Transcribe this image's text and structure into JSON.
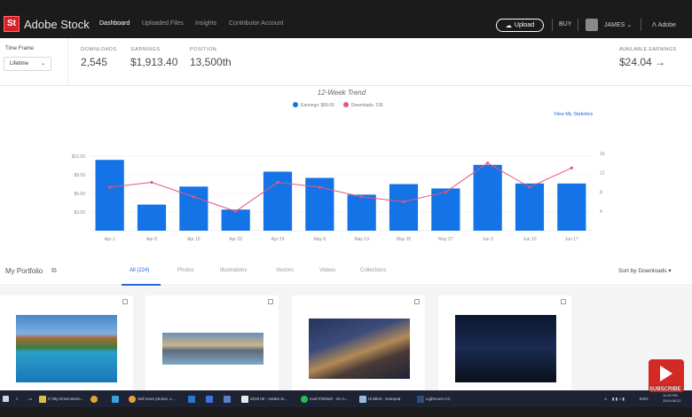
{
  "nav": {
    "brand": "Adobe Stock",
    "logo": "St",
    "items": [
      "Dashboard",
      "Uploaded Files",
      "Insights",
      "Contributor Account"
    ],
    "upload": "Upload",
    "buy": "BUY",
    "user": "JAMES",
    "user_chevron": "⌄",
    "adobe": "Adobe"
  },
  "stats": {
    "timeframe_label": "Time Frame",
    "timeframe_value": "Lifetime",
    "downloads_label": "DOWNLOADS",
    "downloads_value": "2,545",
    "earnings_label": "EARNINGS",
    "earnings_value": "$1,913.40",
    "position_label": "POSITION",
    "position_value": "13,500th",
    "available_label": "AVAILABLE EARNINGS",
    "available_value": "$24.04 →"
  },
  "chart_data": {
    "type": "bar",
    "title": "12-Week Trend",
    "legend": [
      "Earnings: $89.00",
      "Downloads: 106"
    ],
    "view_stats": "View My Statistics",
    "categories": [
      "Apr 1",
      "Apr 8",
      "Apr 15",
      "Apr 22",
      "Apr 29",
      "May 6",
      "May 13",
      "May 20",
      "May 27",
      "Jun 3",
      "Jun 10",
      "Jun 17"
    ],
    "left_ticks": [
      "$3.00",
      "$6.00",
      "$9.00",
      "$12.00"
    ],
    "left_tick_values": [
      3,
      6,
      9,
      12
    ],
    "right_ticks": [
      "4",
      "8",
      "12",
      "16"
    ],
    "right_tick_values": [
      4,
      8,
      12,
      16
    ],
    "ylim_left": [
      0,
      14
    ],
    "ylim_right": [
      0,
      18
    ],
    "series": [
      {
        "name": "Earnings: $89.00",
        "kind": "bar",
        "axis": "left",
        "color": "#1473e6",
        "values": [
          11.4,
          4.2,
          7.1,
          3.4,
          9.5,
          8.5,
          5.8,
          7.5,
          6.8,
          10.6,
          7.6,
          7.6
        ]
      },
      {
        "name": "Downloads: 106",
        "kind": "line",
        "axis": "right",
        "color": "#e8567a",
        "values": [
          9,
          10,
          7,
          4,
          10,
          9,
          7,
          6,
          8,
          14,
          9,
          13
        ]
      }
    ]
  },
  "portfolio": {
    "title": "My Portfolio",
    "ext_icon": "⧉",
    "tabs": [
      "All (224)",
      "Photos",
      "Illustrations",
      "Vectors",
      "Videos",
      "Collections"
    ],
    "sort": "Sort by Downloads ▾"
  },
  "taskbar": {
    "items": [
      "C:\\My Drive\\Jamie...",
      "Sell more photos, v...",
      "2019 06 - Adobe st...",
      "Iced Pinkbelt - On A...",
      "Untitled - Notepad",
      "Lightroom CC"
    ],
    "tray": [
      "∧",
      "ENG"
    ],
    "time": "11:53 PM",
    "date": "2019-06-22"
  },
  "overlay": {
    "subscribe": "SUBSCRIBE"
  },
  "colors": {
    "accent": "#2962d9",
    "bar": "#1473e6",
    "line": "#e8567a",
    "nav_bg": "#1b1b1b",
    "brand_red": "#da1f26"
  }
}
